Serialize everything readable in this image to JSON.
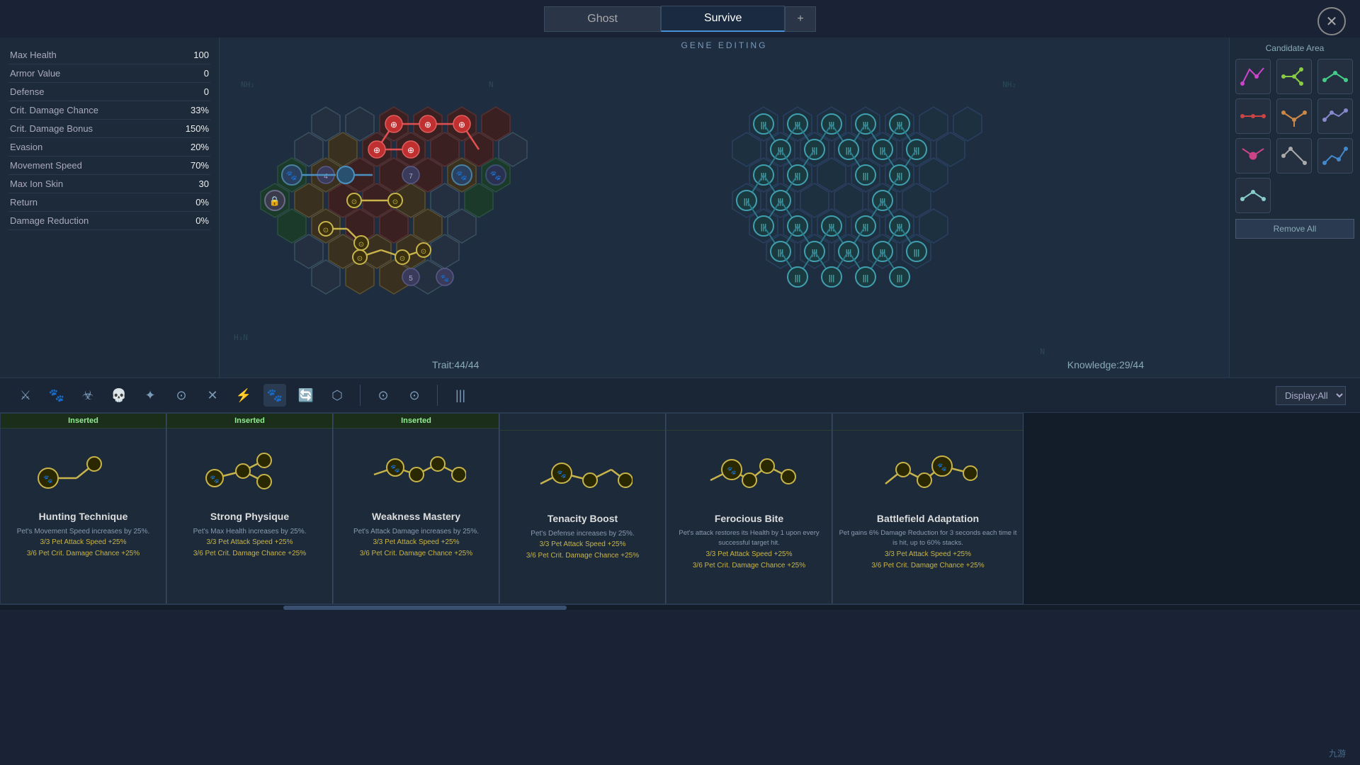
{
  "tabs": [
    {
      "label": "Ghost",
      "active": false
    },
    {
      "label": "Survive",
      "active": true
    },
    {
      "label": "+",
      "active": false
    }
  ],
  "close_label": "✕",
  "stats": [
    {
      "label": "Max Health",
      "value": "100"
    },
    {
      "label": "Armor Value",
      "value": "0"
    },
    {
      "label": "Defense",
      "value": "0"
    },
    {
      "label": "Crit. Damage Chance",
      "value": "33%"
    },
    {
      "label": "Crit. Damage Bonus",
      "value": "150%"
    },
    {
      "label": "Evasion",
      "value": "20%"
    },
    {
      "label": "Movement Speed",
      "value": "70%"
    },
    {
      "label": "Max Ion Skin",
      "value": "30"
    },
    {
      "label": "Return",
      "value": "0%"
    },
    {
      "label": "Damage Reduction",
      "value": "0%"
    }
  ],
  "gene_title": "GENE EDITING",
  "trait_label": "Trait:44/44",
  "knowledge_label": "Knowledge:29/44",
  "candidate_title": "Candidate Area",
  "remove_all_label": "Remove All",
  "display_label": "Display:All",
  "toolbar_icons": [
    "⚔",
    "🐾",
    "☣",
    "💀",
    "✦",
    "⊙",
    "✕",
    "⚡",
    "🐾",
    "🔄",
    "⬡",
    "|",
    "⊙",
    "⊙",
    "|||"
  ],
  "cards": [
    {
      "badge": "Inserted",
      "name": "Hunting Technique",
      "desc": "Pet's Movement Speed increases by 25%.",
      "bonuses": [
        "3/3 Pet Attack Speed +25%",
        "3/6 Pet Crit. Damage Chance +25%"
      ],
      "color": "#c8b44a",
      "chain_color": "#c8b44a",
      "chain_type": "simple"
    },
    {
      "badge": "Inserted",
      "name": "Strong Physique",
      "desc": "Pet's Max Health increases by 25%.",
      "bonuses": [
        "3/3 Pet Attack Speed +25%",
        "3/6 Pet Crit. Damage Chance +25%"
      ],
      "color": "#c8b44a",
      "chain_color": "#c8b44a",
      "chain_type": "branch"
    },
    {
      "badge": "Inserted",
      "name": "Weakness Mastery",
      "desc": "Pet's Attack Damage increases by 25%.",
      "bonuses": [
        "3/3 Pet Attack Speed +25%",
        "3/6 Pet Crit. Damage Chance +25%"
      ],
      "color": "#c8b44a",
      "chain_color": "#c8b44a",
      "chain_type": "double"
    },
    {
      "badge": "",
      "name": "Tenacity Boost",
      "desc": "Pet's Defense increases by 25%.",
      "bonuses": [
        "3/3 Pet Attack Speed +25%",
        "3/6 Pet Crit. Damage Chance +25%"
      ],
      "color": "#c8b44a",
      "chain_color": "#c8b44a",
      "chain_type": "wave"
    },
    {
      "badge": "",
      "name": "Ferocious Bite",
      "desc": "Pet's attack restores its Health by 1 upon every successful target hit.",
      "bonuses": [
        "3/3 Pet Attack Speed +25%",
        "3/6 Pet Crit. Damage Chance +25%"
      ],
      "color": "#c8b44a",
      "chain_color": "#c8b44a",
      "chain_type": "star"
    },
    {
      "badge": "",
      "name": "Battlefield Adaptation",
      "desc": "Pet gains 6% Damage Reduction for 3 seconds each time it is hit, up to 60% stacks.",
      "bonuses": [
        "3/3 Pet Attack Speed +25%",
        "3/6 Pet Crit. Damage Chance +25%"
      ],
      "color": "#c8b44a",
      "chain_color": "#c8b44a",
      "chain_type": "fork"
    }
  ],
  "candidate_items": [
    {
      "color": "#cc44cc",
      "type": "curved"
    },
    {
      "color": "#88cc44",
      "type": "branch"
    },
    {
      "color": "#44cc88",
      "type": "single"
    },
    {
      "color": "#cc4444",
      "type": "small"
    },
    {
      "color": "#cc8844",
      "type": "branch2"
    },
    {
      "color": "#8888cc",
      "type": "curved2"
    },
    {
      "color": "#cc4488",
      "type": "small2"
    },
    {
      "color": "#aaaaaa",
      "type": "curved3"
    },
    {
      "color": "#4488cc",
      "type": "curved4"
    },
    {
      "color": "#88cccc",
      "type": "small3"
    }
  ]
}
